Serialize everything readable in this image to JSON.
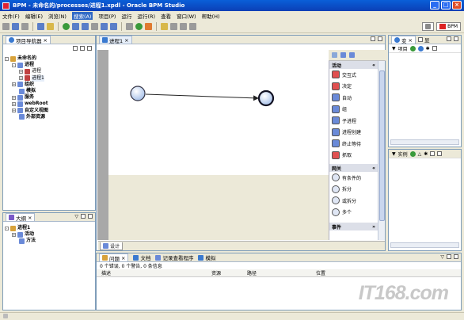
{
  "window": {
    "title": "BPM - 未命名的/processes/进程1.xpdl - Oracle BPM Studio",
    "minimize": "_",
    "maximize": "□",
    "close": "×"
  },
  "menu": [
    "文件(F)",
    "编辑(E)",
    "浏览(N)",
    "搜索(A)",
    "项目(P)",
    "运行",
    "运行(R)",
    "查看",
    "窗口(W)",
    "帮助(H)"
  ],
  "perspective": {
    "label": "BPM"
  },
  "project_navigator": {
    "tab": "项目导航器",
    "items": [
      {
        "label": "未命名的",
        "level": 0,
        "exp": "-"
      },
      {
        "label": "进程",
        "level": 1,
        "exp": "-"
      },
      {
        "label": "进程",
        "level": 2,
        "exp": "+"
      },
      {
        "label": "进程1",
        "level": 2,
        "exp": "+",
        "selected": true
      },
      {
        "label": "组织",
        "level": 1,
        "exp": "+"
      },
      {
        "label": "模拟",
        "level": 1,
        "exp": ""
      },
      {
        "label": "服务",
        "level": 1,
        "exp": "+"
      },
      {
        "label": "webRoot",
        "level": 1,
        "exp": "+"
      },
      {
        "label": "自定义视图",
        "level": 1,
        "exp": "+"
      },
      {
        "label": "外部资源",
        "level": 1,
        "exp": ""
      }
    ]
  },
  "outline": {
    "tab": "大纲",
    "items": [
      {
        "label": "进程1",
        "level": 0,
        "exp": "-"
      },
      {
        "label": "活动",
        "level": 1,
        "exp": "+"
      },
      {
        "label": "方法",
        "level": 1,
        "exp": ""
      }
    ]
  },
  "editor": {
    "tab": "进程1",
    "bottom_tab": "设计",
    "palette": {
      "activities_header": "活动",
      "activities": [
        {
          "label": "交互式",
          "color": "#e05050"
        },
        {
          "label": "决定",
          "color": "#e05050"
        },
        {
          "label": "自动",
          "color": "#6a8ad8"
        },
        {
          "label": "组",
          "color": "#6a8ad8"
        },
        {
          "label": "子进程",
          "color": "#6a8ad8"
        },
        {
          "label": "进程创建",
          "color": "#6a8ad8"
        },
        {
          "label": "终止等待",
          "color": "#6a8ad8"
        },
        {
          "label": "抓取",
          "color": "#e05050"
        }
      ],
      "gateways_header": "网关",
      "gateways": [
        {
          "label": "有条件的"
        },
        {
          "label": "拆分"
        },
        {
          "label": "或拆分"
        },
        {
          "label": "多个"
        }
      ],
      "events_header": "事件"
    }
  },
  "right_top": {
    "tab1": "变",
    "tab2": "显",
    "section": "项目"
  },
  "right_bottom": {
    "section": "实例"
  },
  "problems": {
    "tabs": [
      "问题",
      "文档",
      "记录查看程序",
      "模拟"
    ],
    "summary": "0 个错误, 0 个警告, 0 条信息",
    "columns": [
      "描述",
      "资源",
      "路径",
      "位置"
    ]
  },
  "watermark": "IT168.com"
}
